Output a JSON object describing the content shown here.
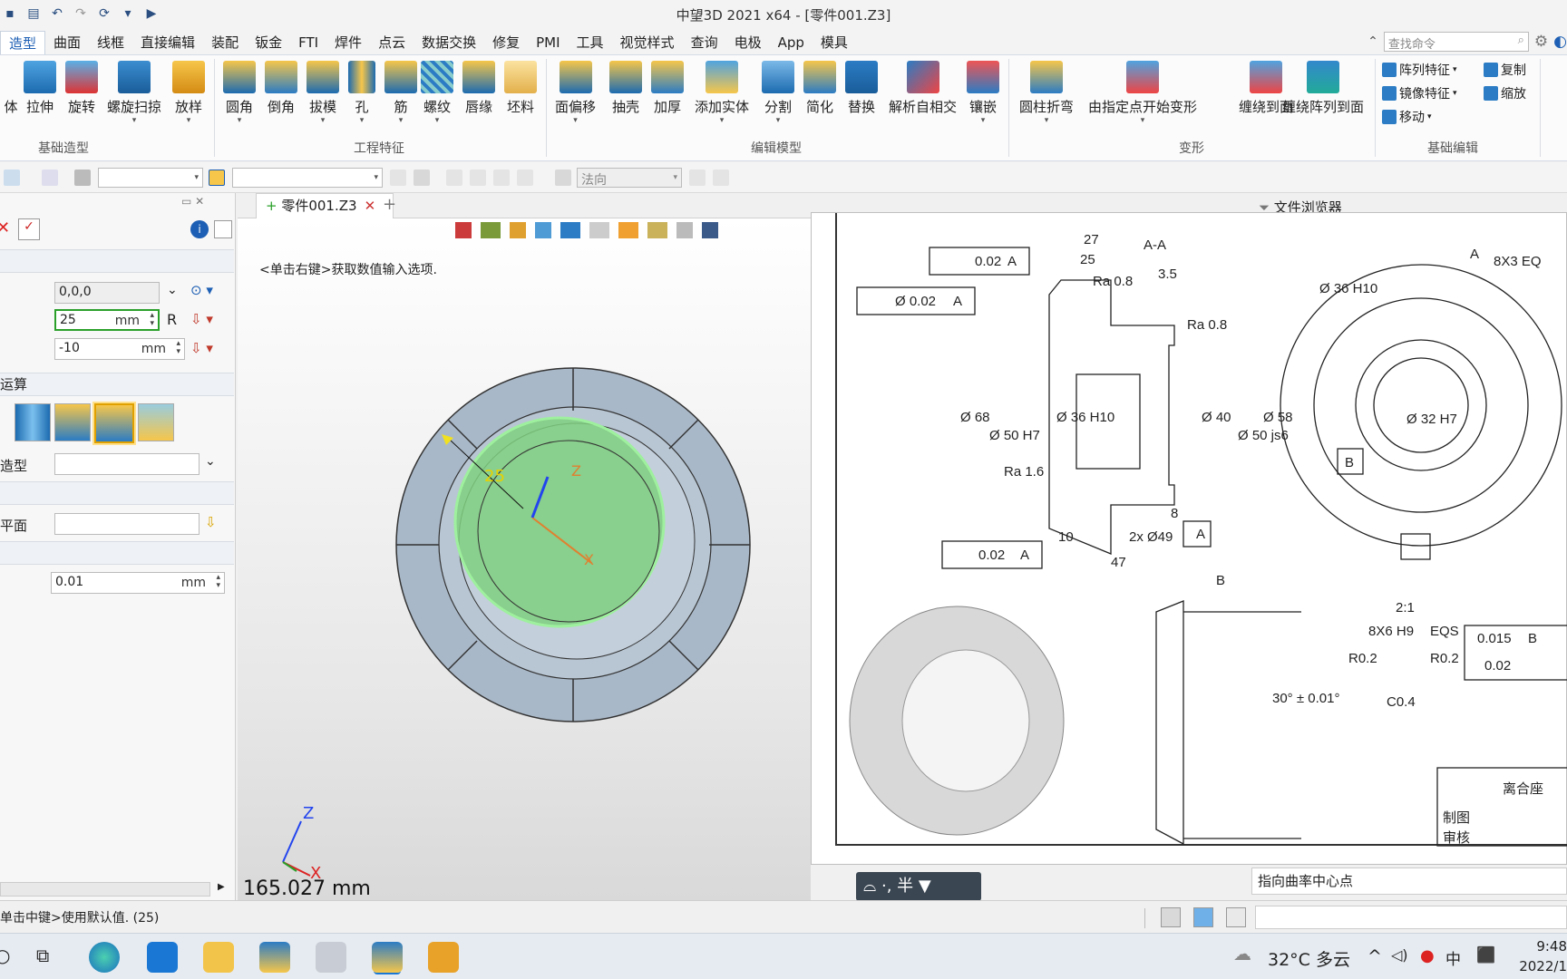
{
  "window": {
    "title": "中望3D 2021 x64 - [零件001.Z3]"
  },
  "menu_tabs": [
    "造型",
    "曲面",
    "线框",
    "直接编辑",
    "装配",
    "钣金",
    "FTI",
    "焊件",
    "点云",
    "数据交换",
    "修复",
    "PMI",
    "工具",
    "视觉样式",
    "查询",
    "电极",
    "App",
    "模具"
  ],
  "search": {
    "placeholder": "查找命令"
  },
  "ribbon": {
    "groups": [
      "基础造型",
      "工程特征",
      "编辑模型",
      "变形",
      "基础编辑"
    ],
    "buttons": [
      "体",
      "拉伸",
      "旋转",
      "螺旋扫掠",
      "放样",
      "圆角",
      "倒角",
      "拔模",
      "孔",
      "筋",
      "螺纹",
      "唇缘",
      "坯料",
      "面偏移",
      "抽壳",
      "加厚",
      "添加实体",
      "分割",
      "简化",
      "替换",
      "解析自相交",
      "镶嵌",
      "圆柱折弯",
      "由指定点开始变形",
      "缠绕到面",
      "缠绕阵列到面"
    ],
    "small_buttons": [
      "阵列特征",
      "复制",
      "镜像特征",
      "缩放",
      "移动"
    ]
  },
  "toolbar2": {
    "direction_label": "法向"
  },
  "left_panel": {
    "field1_value": "0,0,0",
    "field2_value": "25",
    "field2_unit": "mm",
    "field2_suffix": "R",
    "field3_value": "-10",
    "field3_unit": "mm",
    "section_bool": "运算",
    "label_shape": "造型",
    "label_plane": "平面",
    "tolerance_value": "0.01",
    "tolerance_unit": "mm"
  },
  "tabs": {
    "doc_tab": "零件001.Z3",
    "add": "+"
  },
  "viewport": {
    "hint": "<单击右键>获取数值输入选项.",
    "dim_label": "25",
    "axis_x": "X",
    "axis_z": "Z",
    "measure": "165.027 mm"
  },
  "drawing": {
    "gdt1": [
      "0.02",
      "A"
    ],
    "gdt2": [
      "Ø 0.02",
      "A"
    ],
    "gdt3": [
      "0.02",
      "A"
    ],
    "section_label": "A-A",
    "dims": [
      "27",
      "25",
      "3.5",
      "Ra 0.8",
      "Ra 0.8",
      "Ø 68",
      "Ø 50 H7",
      "Ø 36 H10",
      "Ø 40",
      "Ø 50 js6",
      "Ø 58",
      "Ra 1.6",
      "8",
      "10",
      "2x Ø49",
      "47",
      "Ø 36 H10",
      "8X3 EQ",
      "Ø 32 H7",
      "A",
      "A",
      "B",
      "B",
      "2:1",
      "8X6 H9",
      "EQS",
      "R0.2",
      "R0.2",
      "C0.4",
      "30° ± 0.01°",
      "0.015",
      "0.02",
      "B",
      "离合座",
      "制图",
      "审核"
    ]
  },
  "file_browser": "文件浏览器",
  "hud": "·, 半",
  "curve_hint": "指向曲率中心点",
  "status": {
    "message": "单击中键>使用默认值. (25)"
  },
  "taskbar": {
    "weather": "32°C  多云",
    "time": "9:48",
    "date": "2022/1"
  }
}
